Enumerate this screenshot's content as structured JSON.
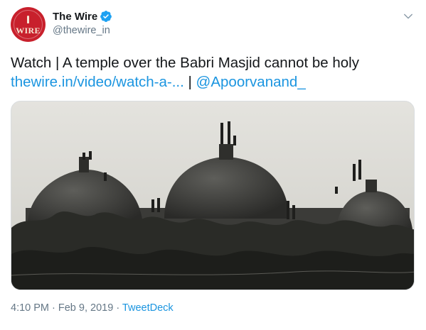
{
  "account": {
    "name": "The Wire",
    "handle": "@thewire_in",
    "avatar_text": "WIRE",
    "verified": true
  },
  "tweet": {
    "text": "Watch | A temple over the Babri Masjid cannot be holy",
    "link": "thewire.in/video/watch-a-...",
    "separator": " | ",
    "mention": "@Apoorvanand_"
  },
  "meta": {
    "time": "4:10 PM",
    "dot": " · ",
    "date": "Feb 9, 2019",
    "source": "TweetDeck"
  },
  "colors": {
    "link": "#1b95e0",
    "secondary_text": "#657786",
    "avatar_bg": "#c8202c"
  },
  "icons": {
    "verified": "verified-badge-icon",
    "menu": "chevron-down-icon"
  }
}
